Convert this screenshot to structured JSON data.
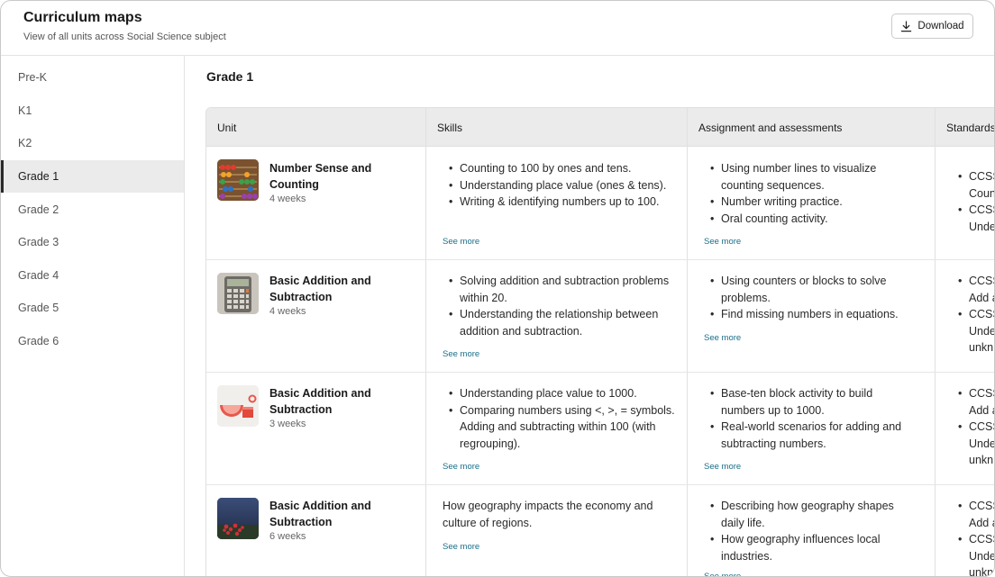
{
  "header": {
    "title": "Curriculum maps",
    "subtitle": "View of all units across Social Science subject",
    "download_label": "Download"
  },
  "sidebar": {
    "items": [
      "Pre-K",
      "K1",
      "K2",
      "Grade 1",
      "Grade 2",
      "Grade 3",
      "Grade 4",
      "Grade 5",
      "Grade 6"
    ],
    "active": "Grade 1"
  },
  "main": {
    "grade_title": "Grade 1",
    "columns": [
      "Unit",
      "Skills",
      "Assignment and assessments",
      "Standards"
    ],
    "see_more_label": "See more",
    "rows": [
      {
        "unit": "Number Sense and Counting",
        "duration": "4 weeks",
        "thumb_icon": "abacus-image",
        "skills": [
          "Counting to 100 by ones and tens.",
          "Understanding place value (ones & tens).",
          "Writing & identifying numbers up to 100."
        ],
        "assessments": [
          "Using number lines to visualize counting sequences.",
          "Number writing practice.",
          "Oral counting activity."
        ],
        "standards": [
          "CCSS Coun",
          "CCSS Unde"
        ]
      },
      {
        "unit": "Basic Addition and Subtraction",
        "duration": "4 weeks",
        "thumb_icon": "calculator-image",
        "skills": [
          "Solving addition and subtraction problems within 20.",
          "Understanding the relationship between addition and subtraction."
        ],
        "assessments": [
          "Using counters or blocks to solve problems.",
          "Find missing numbers in equations."
        ],
        "standards": [
          "CCSS Add a",
          "CCSS Unde unkn"
        ]
      },
      {
        "unit": "Basic Addition and Subtraction",
        "duration": "3 weeks",
        "thumb_icon": "shapes-image",
        "skills": [
          "Understanding place value to 1000.",
          "Comparing numbers using <, >, = symbols. Adding and subtracting within 100 (with regrouping)."
        ],
        "assessments": [
          "Base-ten block activity to build numbers up to 1000.",
          "Real-world scenarios for adding and subtracting numbers."
        ],
        "standards": [
          "CCSS Add a",
          "CCSS Unde unkn"
        ]
      },
      {
        "unit": "Basic Addition and Subtraction",
        "duration": "6 weeks",
        "thumb_icon": "flowers-night-image",
        "skills_text": "How geography impacts the economy and culture of regions.",
        "assessments": [
          "Describing how geography shapes daily life.",
          "How geography influences local industries."
        ],
        "standards": [
          "CCSS Add a",
          "CCSS Unde unkn"
        ]
      }
    ]
  }
}
